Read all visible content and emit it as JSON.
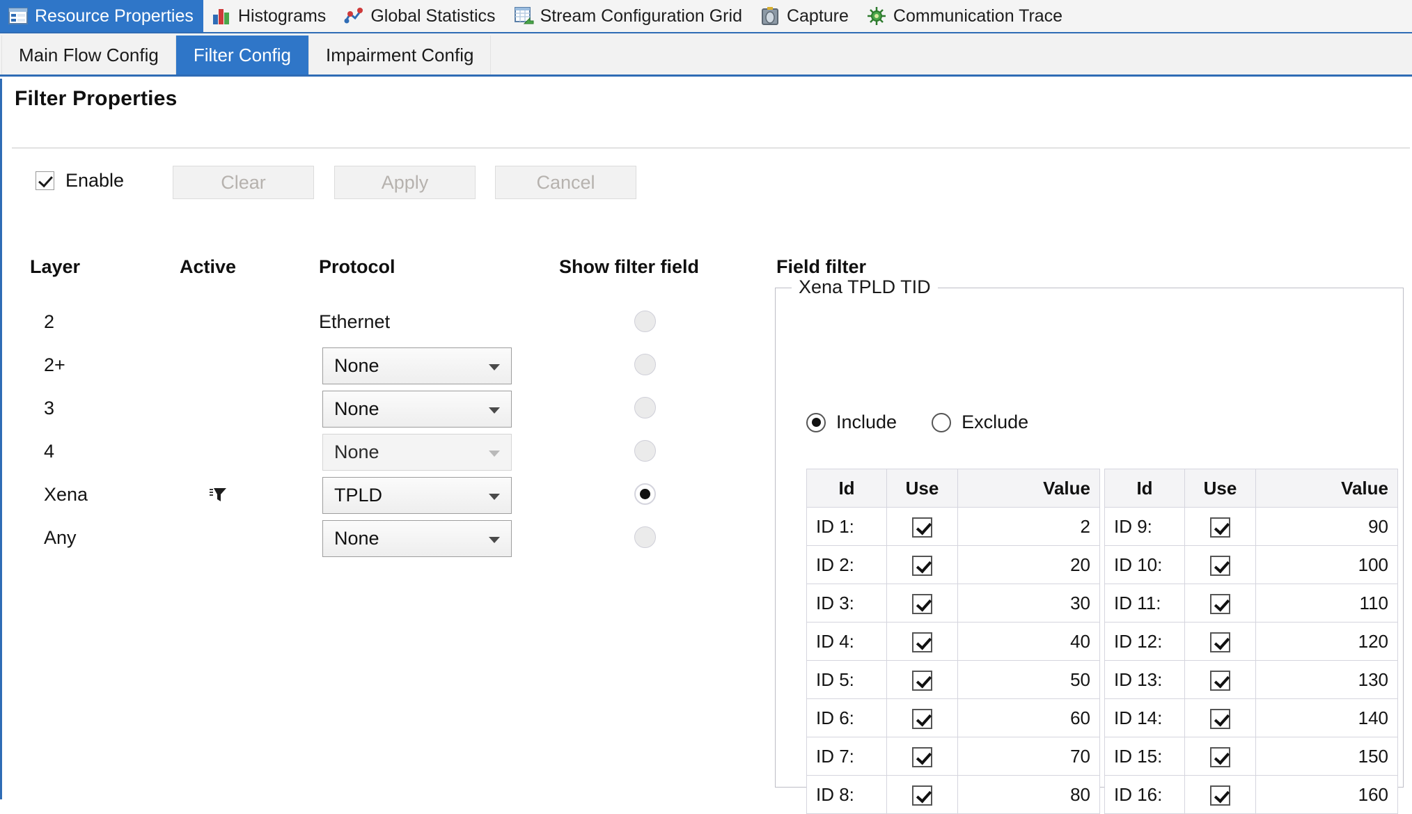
{
  "window": {
    "top_tabs": [
      {
        "label": "Resource Properties",
        "icon": "resource-properties-icon",
        "active": true
      },
      {
        "label": "Histograms",
        "icon": "histogram-icon",
        "active": false
      },
      {
        "label": "Global Statistics",
        "icon": "global-statistics-icon",
        "active": false
      },
      {
        "label": "Stream Configuration Grid",
        "icon": "stream-config-grid-icon",
        "active": false
      },
      {
        "label": "Capture",
        "icon": "capture-camera-icon",
        "active": false
      },
      {
        "label": "Communication Trace",
        "icon": "communication-trace-icon",
        "active": false
      }
    ],
    "sub_tabs": [
      {
        "label": "Main Flow Config",
        "active": false
      },
      {
        "label": "Filter Config",
        "active": true
      },
      {
        "label": "Impairment Config",
        "active": false
      }
    ]
  },
  "page": {
    "title": "Filter Properties"
  },
  "toolbar": {
    "enable_label": "Enable",
    "enable_checked": true,
    "clear_label": "Clear",
    "apply_label": "Apply",
    "cancel_label": "Cancel",
    "buttons_disabled": true
  },
  "filter_table": {
    "headers": {
      "layer": "Layer",
      "active": "Active",
      "protocol": "Protocol",
      "show_filter_field": "Show filter field",
      "field_filter": "Field filter"
    },
    "rows": [
      {
        "layer": "2",
        "active_icon": "",
        "protocol": "Ethernet",
        "protocol_kind": "static",
        "disabled": false,
        "selected": false
      },
      {
        "layer": "2+",
        "active_icon": "",
        "protocol": "None",
        "protocol_kind": "dropdown",
        "disabled": false,
        "selected": false
      },
      {
        "layer": "3",
        "active_icon": "",
        "protocol": "None",
        "protocol_kind": "dropdown",
        "disabled": false,
        "selected": false
      },
      {
        "layer": "4",
        "active_icon": "",
        "protocol": "None",
        "protocol_kind": "dropdown",
        "disabled": true,
        "selected": false
      },
      {
        "layer": "Xena",
        "active_icon": "filter-funnel-icon",
        "protocol": "TPLD",
        "protocol_kind": "dropdown",
        "disabled": false,
        "selected": true
      },
      {
        "layer": "Any",
        "active_icon": "",
        "protocol": "None",
        "protocol_kind": "dropdown",
        "disabled": false,
        "selected": false
      }
    ]
  },
  "field_filter": {
    "group_title": "Xena TPLD TID",
    "mode": {
      "include_label": "Include",
      "exclude_label": "Exclude",
      "selected": "Include"
    },
    "columns": {
      "id": "Id",
      "use": "Use",
      "value": "Value"
    },
    "left_rows": [
      {
        "id": "ID 1:",
        "use": true,
        "value": "2"
      },
      {
        "id": "ID 2:",
        "use": true,
        "value": "20"
      },
      {
        "id": "ID 3:",
        "use": true,
        "value": "30"
      },
      {
        "id": "ID 4:",
        "use": true,
        "value": "40"
      },
      {
        "id": "ID 5:",
        "use": true,
        "value": "50"
      },
      {
        "id": "ID 6:",
        "use": true,
        "value": "60"
      },
      {
        "id": "ID 7:",
        "use": true,
        "value": "70"
      },
      {
        "id": "ID 8:",
        "use": true,
        "value": "80"
      }
    ],
    "right_rows": [
      {
        "id": "ID 9:",
        "use": true,
        "value": "90"
      },
      {
        "id": "ID 10:",
        "use": true,
        "value": "100"
      },
      {
        "id": "ID 11:",
        "use": true,
        "value": "110"
      },
      {
        "id": "ID 12:",
        "use": true,
        "value": "120"
      },
      {
        "id": "ID 13:",
        "use": true,
        "value": "130"
      },
      {
        "id": "ID 14:",
        "use": true,
        "value": "140"
      },
      {
        "id": "ID 15:",
        "use": true,
        "value": "150"
      },
      {
        "id": "ID 16:",
        "use": true,
        "value": "160"
      }
    ]
  },
  "colors": {
    "accent": "#2f76c8",
    "accent_border": "#2f6cb5",
    "panel_bg": "#ffffff",
    "tabstrip_bg": "#f4f4f4",
    "disabled_text": "#b6b2ae"
  }
}
